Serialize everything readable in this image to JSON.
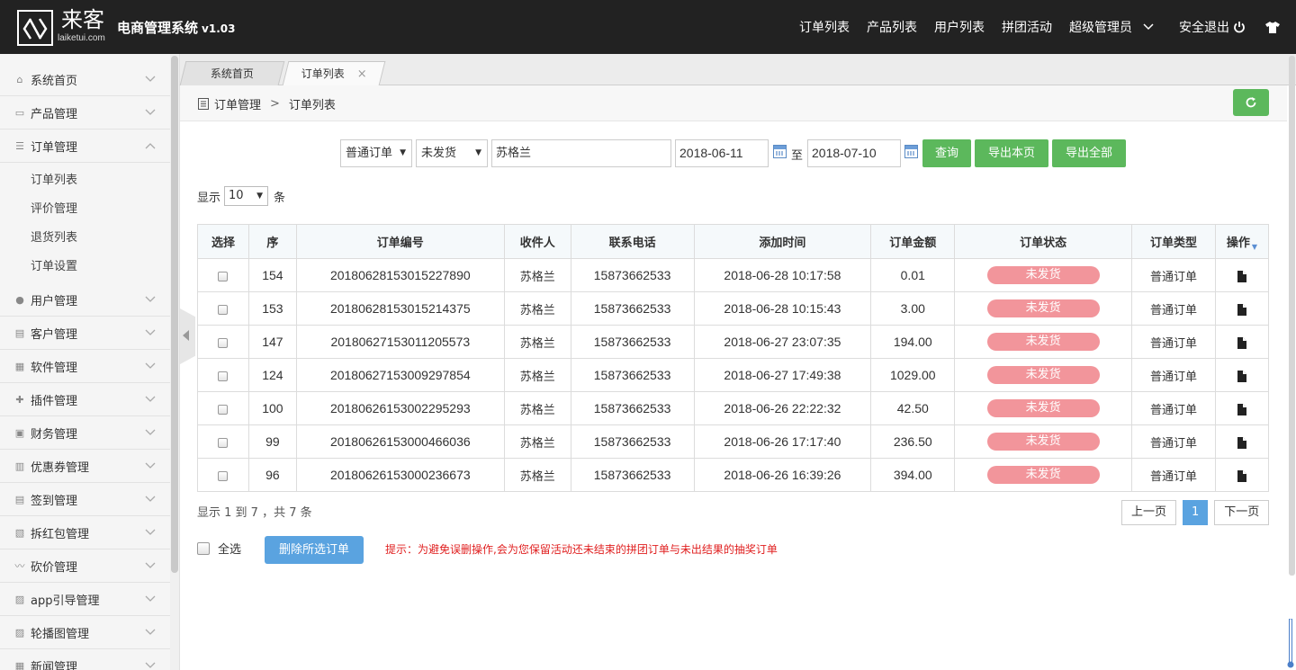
{
  "header": {
    "logo_text": "来客",
    "logo_sub": "laiketui.com",
    "app_title": "电商管理系统",
    "app_version": "v1.03",
    "nav": [
      "订单列表",
      "产品列表",
      "用户列表",
      "拼团活动",
      "超级管理员",
      "安全退出"
    ]
  },
  "sidebar": {
    "items": [
      {
        "label": "系统首页",
        "icon": "home-icon"
      },
      {
        "label": "产品管理",
        "icon": "shop-icon"
      },
      {
        "label": "订单管理",
        "icon": "list-icon"
      },
      {
        "label": "用户管理",
        "icon": "user-icon"
      },
      {
        "label": "客户管理",
        "icon": "customer-icon"
      },
      {
        "label": "软件管理",
        "icon": "grid-icon"
      },
      {
        "label": "插件管理",
        "icon": "puzzle-icon"
      },
      {
        "label": "财务管理",
        "icon": "finance-icon"
      },
      {
        "label": "优惠券管理",
        "icon": "coupon-icon"
      },
      {
        "label": "签到管理",
        "icon": "checkin-icon"
      },
      {
        "label": "拆红包管理",
        "icon": "redpacket-icon"
      },
      {
        "label": "砍价管理",
        "icon": "bargain-icon"
      },
      {
        "label": "app引导管理",
        "icon": "image-icon"
      },
      {
        "label": "轮播图管理",
        "icon": "image-icon"
      },
      {
        "label": "新闻管理",
        "icon": "news-icon"
      }
    ],
    "subitems": [
      "订单列表",
      "评价管理",
      "退货列表",
      "订单设置"
    ]
  },
  "tabs": {
    "home": "系统首页",
    "orders": "订单列表",
    "close": "×"
  },
  "breadcrumb": {
    "root": "订单管理",
    "sep": ">",
    "current": "订单列表"
  },
  "filters": {
    "order_type": "普通订单",
    "ship_status": "未发货",
    "keyword": "苏格兰",
    "date_from": "2018-06-11",
    "to_label": "至",
    "date_to": "2018-07-10",
    "btn_query": "查询",
    "btn_export_page": "导出本页",
    "btn_export_all": "导出全部"
  },
  "page_size": {
    "prefix": "显示",
    "value": "10",
    "suffix": "条"
  },
  "table": {
    "headers": [
      "选择",
      "序",
      "订单编号",
      "收件人",
      "联系电话",
      "添加时间",
      "订单金额",
      "订单状态",
      "订单类型",
      "操作"
    ],
    "rows": [
      {
        "seq": "154",
        "order_no": "20180628153015227890",
        "name": "苏格兰",
        "phone": "15873662533",
        "time": "2018-06-28 10:17:58",
        "amount": "0.01",
        "status": "未发货",
        "type": "普通订单"
      },
      {
        "seq": "153",
        "order_no": "20180628153015214375",
        "name": "苏格兰",
        "phone": "15873662533",
        "time": "2018-06-28 10:15:43",
        "amount": "3.00",
        "status": "未发货",
        "type": "普通订单"
      },
      {
        "seq": "147",
        "order_no": "20180627153011205573",
        "name": "苏格兰",
        "phone": "15873662533",
        "time": "2018-06-27 23:07:35",
        "amount": "194.00",
        "status": "未发货",
        "type": "普通订单"
      },
      {
        "seq": "124",
        "order_no": "20180627153009297854",
        "name": "苏格兰",
        "phone": "15873662533",
        "time": "2018-06-27 17:49:38",
        "amount": "1029.00",
        "status": "未发货",
        "type": "普通订单"
      },
      {
        "seq": "100",
        "order_no": "20180626153002295293",
        "name": "苏格兰",
        "phone": "15873662533",
        "time": "2018-06-26 22:22:32",
        "amount": "42.50",
        "status": "未发货",
        "type": "普通订单"
      },
      {
        "seq": "99",
        "order_no": "20180626153000466036",
        "name": "苏格兰",
        "phone": "15873662533",
        "time": "2018-06-26 17:17:40",
        "amount": "236.50",
        "status": "未发货",
        "type": "普通订单"
      },
      {
        "seq": "96",
        "order_no": "20180626153000236673",
        "name": "苏格兰",
        "phone": "15873662533",
        "time": "2018-06-26 16:39:26",
        "amount": "394.00",
        "status": "未发货",
        "type": "普通订单"
      }
    ]
  },
  "footer": {
    "range_text": "显示 1 到 7 ，共 7 条",
    "prev": "上一页",
    "page": "1",
    "next": "下一页",
    "select_all": "全选",
    "delete_btn": "删除所选订单",
    "tip": "提示：为避免误删操作,会为您保留活动还未结束的拼团订单与未出结果的抽奖订单"
  },
  "colors": {
    "topbar": "#222222",
    "accent_green": "#5cb85c",
    "accent_blue": "#5aa3e0",
    "status_badge": "#f2959b",
    "tip_red": "#e02020"
  }
}
